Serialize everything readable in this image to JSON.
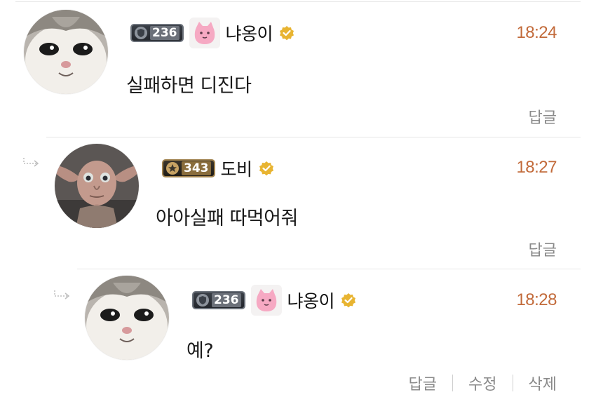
{
  "comments": [
    {
      "nickname": "냐옹이",
      "level": "236",
      "time": "18:24",
      "text": "실패하면 디진다",
      "actions": {
        "reply": "답글"
      }
    },
    {
      "nickname": "도비",
      "level": "343",
      "time": "18:27",
      "text": "아아실패 따먹어줘",
      "actions": {
        "reply": "답글"
      }
    },
    {
      "nickname": "냐옹이",
      "level": "236",
      "time": "18:28",
      "text": "예?",
      "actions": {
        "reply": "답글",
        "edit": "수정",
        "delete": "삭제"
      }
    }
  ],
  "colors": {
    "timestamp": "#c26a3a",
    "verified": "#e8b431",
    "action_text": "#8a8a8a",
    "divider": "#e6e6e6"
  },
  "icons": {
    "verified": "verified-badge-icon",
    "reply_arrow": "reply-arrow-icon",
    "level_silver": "shield-level-icon",
    "level_gold": "star-level-icon",
    "sticker": "pink-cat-sticker"
  }
}
